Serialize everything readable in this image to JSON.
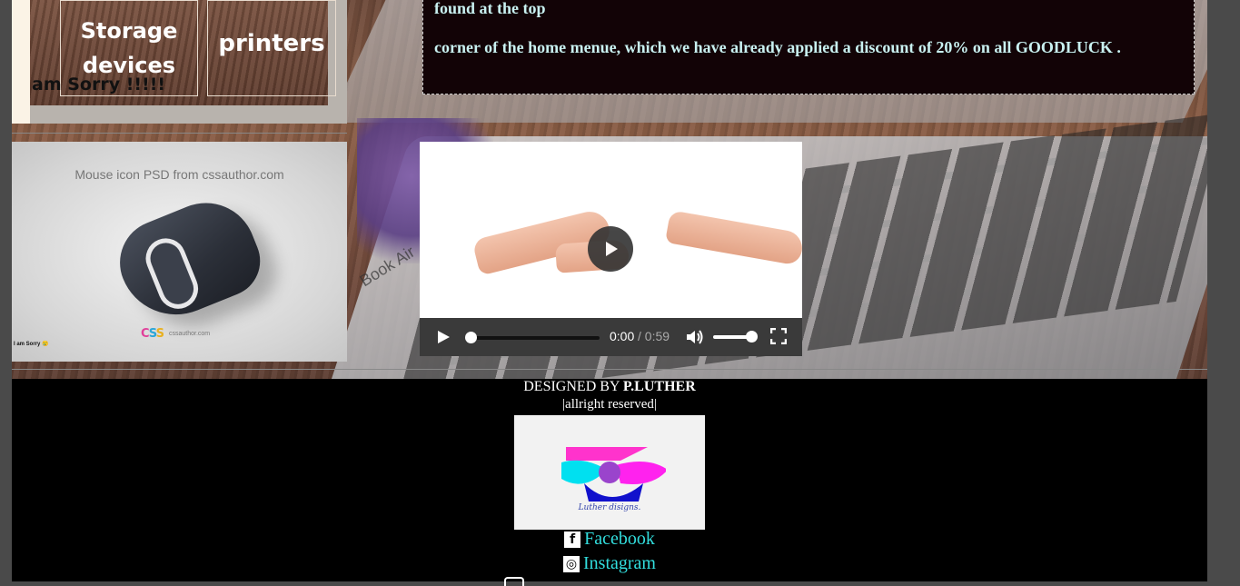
{
  "menu": {
    "storage_label_line1": "Storage",
    "storage_label_line2": "devices",
    "printers_label": "printers",
    "sorry_text": "am Sorry !!!!!"
  },
  "info_box": {
    "line1": "found at the top",
    "line2": "corner of the home menue, which we have already applied a discount of 20% on all GOODLUCK ."
  },
  "mouse_image": {
    "caption": "Mouse icon PSD from cssauthor.com",
    "logo_c1": "C",
    "logo_c2": "S",
    "logo_c3": "S",
    "site": "cssauthor.com",
    "sorry_small": "I am Sorry 😢"
  },
  "background": {
    "brand_text": "Book Air"
  },
  "video": {
    "time_current": "0:00",
    "time_separator": " / ",
    "time_total": "0:59",
    "progress": 0.0,
    "volume": 0.85
  },
  "footer": {
    "designed_prefix": "DESIGNED BY ",
    "designer": "P.LUTHER",
    "rights": "|allright reserved|",
    "logo_caption": "Luther disigns.",
    "facebook_label": "Facebook",
    "instagram_label": "Instagram"
  },
  "colors": {
    "link": "#32dede",
    "info_text": "#c9f1f1",
    "info_bg": "#120306"
  }
}
